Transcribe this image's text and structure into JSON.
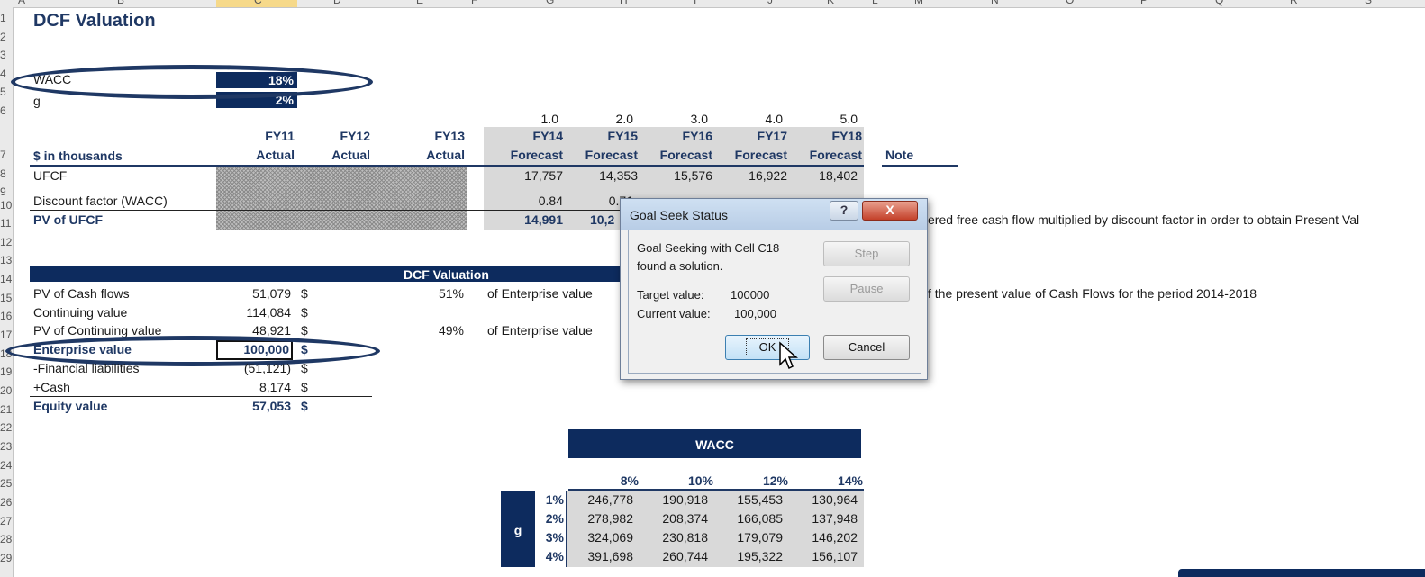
{
  "sheet": {
    "column_letters": [
      "A",
      "B",
      "C",
      "D",
      "E",
      "F",
      "G",
      "H",
      "I",
      "J",
      "K",
      "L",
      "M",
      "N",
      "O",
      "P",
      "Q",
      "R",
      "S"
    ],
    "row_numbers": [
      "1",
      "2",
      "3",
      "4",
      "5",
      "6",
      "7",
      "8",
      "9",
      "10",
      "11",
      "12",
      "13",
      "14",
      "15",
      "16",
      "17",
      "18",
      "19",
      "20",
      "21",
      "22",
      "23",
      "24",
      "25",
      "26",
      "27",
      "28",
      "29"
    ],
    "title": "DCF Valuation",
    "inputs": {
      "wacc_label": "WACC",
      "wacc_value": "18%",
      "g_label": "g",
      "g_value": "2%"
    },
    "periods": [
      "1.0",
      "2.0",
      "3.0",
      "4.0",
      "5.0"
    ],
    "header": {
      "units_label": "$ in thousands",
      "years": [
        "FY11",
        "FY12",
        "FY13",
        "FY14",
        "FY15",
        "FY16",
        "FY17",
        "FY18"
      ],
      "types": [
        "Actual",
        "Actual",
        "Actual",
        "Forecast",
        "Forecast",
        "Forecast",
        "Forecast",
        "Forecast"
      ],
      "note": "Note"
    },
    "rows": {
      "ufcf_label": "UFCF",
      "ufcf": [
        "17,757",
        "14,353",
        "15,576",
        "16,922",
        "18,402"
      ],
      "discount_label": "Discount factor (WACC)",
      "discount": [
        "0.84",
        "0.71"
      ],
      "pv_label": "PV of UFCF",
      "pv": [
        "14,991",
        "10,2"
      ]
    },
    "notes": {
      "pv_note": "ered free cash flow multiplied by discount factor in order to obtain Present Val",
      "cf_note": "f the present value of Cash Flows for the period 2014-2018"
    },
    "valuation": {
      "header": "DCF Valuation",
      "items": [
        {
          "label": "PV of Cash flows",
          "value": "51,079",
          "cur": "$",
          "pct": "51%",
          "desc": "of Enterprise value"
        },
        {
          "label": "Continuing value",
          "value": "114,084",
          "cur": "$",
          "pct": "",
          "desc": ""
        },
        {
          "label": "PV of Continuing value",
          "value": "48,921",
          "cur": "$",
          "pct": "49%",
          "desc": "of Enterprise value"
        },
        {
          "label": "Enterprise value",
          "value": "100,000",
          "cur": "$",
          "pct": "",
          "desc": ""
        },
        {
          "label": "-Financial liabilities",
          "value": "(51,121)",
          "cur": "$",
          "pct": "",
          "desc": ""
        },
        {
          "label": "+Cash",
          "value": "8,174",
          "cur": "$",
          "pct": "",
          "desc": ""
        },
        {
          "label": "Equity value",
          "value": "57,053",
          "cur": "$",
          "pct": "",
          "desc": ""
        }
      ]
    },
    "sensitivity": {
      "title": "WACC",
      "g_label": "g",
      "cols": [
        "8%",
        "10%",
        "12%",
        "14%"
      ],
      "rows": [
        {
          "g": "1%",
          "vals": [
            "246,778",
            "190,918",
            "155,453",
            "130,964"
          ]
        },
        {
          "g": "2%",
          "vals": [
            "278,982",
            "208,374",
            "166,085",
            "137,948"
          ]
        },
        {
          "g": "3%",
          "vals": [
            "324,069",
            "230,818",
            "179,079",
            "146,202"
          ]
        },
        {
          "g": "4%",
          "vals": [
            "391,698",
            "260,744",
            "195,322",
            "156,107"
          ]
        }
      ]
    }
  },
  "dialog": {
    "title": "Goal Seek Status",
    "help": "?",
    "close": "X",
    "message_line1": "Goal Seeking with Cell C18",
    "message_line2": "found a solution.",
    "target_label": "Target value:",
    "target_value": "100000",
    "current_label": "Current value:",
    "current_value": "100,000",
    "step": "Step",
    "pause": "Pause",
    "ok": "OK",
    "cancel": "Cancel"
  }
}
